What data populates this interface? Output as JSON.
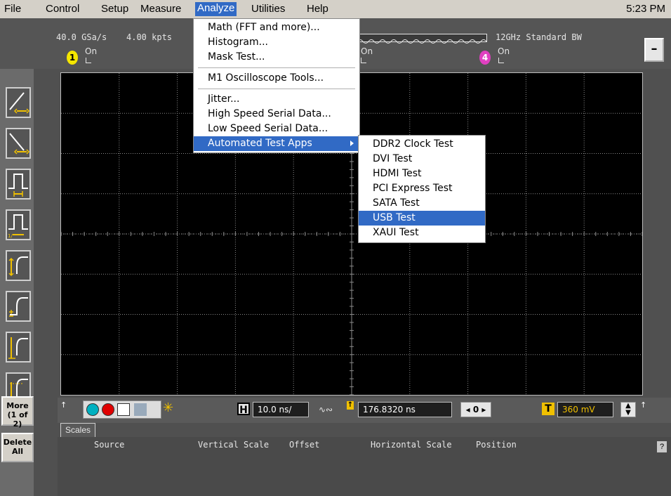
{
  "menubar": {
    "items": [
      "File",
      "Control",
      "Setup",
      "Measure",
      "Analyze",
      "Utilities",
      "Help"
    ],
    "active": "Analyze",
    "clock": "5:23 PM"
  },
  "acquisition": {
    "sample_rate": "40.0 GSa/s",
    "memory_depth": "4.00 kpts",
    "bandwidth": "12GHz Standard BW"
  },
  "channels": [
    {
      "number": "1",
      "state": "On",
      "color": "#f5e600"
    },
    {
      "number": "",
      "state": "On",
      "color": ""
    },
    {
      "number": "4",
      "state": "On",
      "color": "#e040c0"
    }
  ],
  "toolbar": {
    "more_label_1": "More",
    "more_label_2": "(1 of 2)",
    "delete_label_1": "Delete",
    "delete_label_2": "All"
  },
  "controls": {
    "horizontal_badge": "H",
    "time_per_div": "10.0 ns/",
    "horizontal_position": "176.8320 ns",
    "delay_ref": "0",
    "trigger_badge": "T",
    "trigger_level": "360 mV",
    "trigger_color": "#f0c000",
    "small_marker_1": "↑",
    "small_marker_2": "↑"
  },
  "scales": {
    "tab_label": "Scales",
    "headers": [
      "Source",
      "Vertical Scale",
      "Offset",
      "Horizontal Scale",
      "Position"
    ],
    "help_label": "?"
  },
  "analyze_menu": {
    "items": [
      "Math (FFT and more)...",
      "Histogram...",
      "Mask Test...",
      "M1 Oscilloscope Tools...",
      "Jitter...",
      "High Speed Serial Data...",
      "Low Speed Serial Data...",
      "Automated Test Apps"
    ],
    "highlighted": "Automated Test Apps"
  },
  "apps_submenu": {
    "items": [
      "DDR2 Clock Test",
      "DVI Test",
      "HDMI Test",
      "PCI Express Test",
      "SATA Test",
      "USB Test",
      "XAUI Test"
    ],
    "highlighted": "USB Test"
  },
  "colors": {
    "menu_highlight": "#316ac5",
    "grid_line": "#8a8a8a"
  }
}
